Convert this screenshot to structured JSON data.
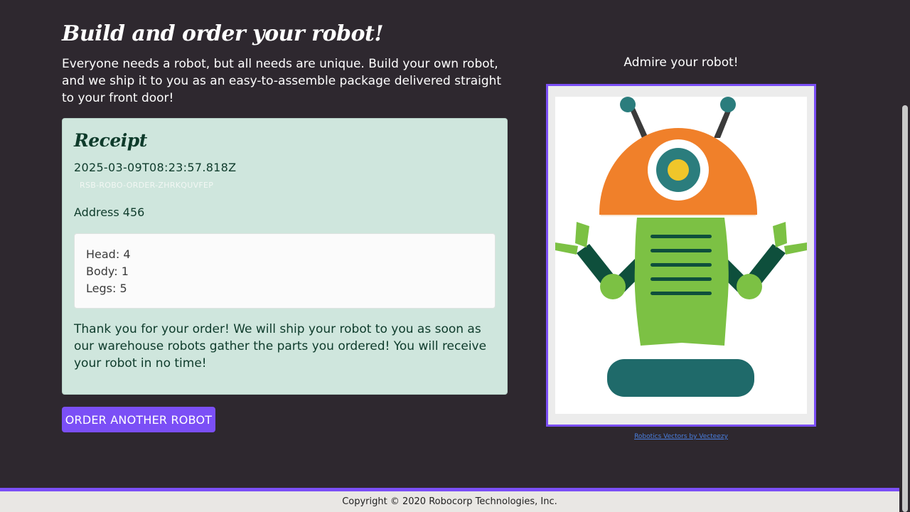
{
  "page": {
    "title": "Build and order your robot!",
    "intro": "Everyone needs a robot, but all needs are unique. Build your own robot, and we ship it to you as an easy-to-assemble package delivered straight to your front door!"
  },
  "receipt": {
    "title": "Receipt",
    "timestamp": "2025-03-09T08:23:57.818Z",
    "order_id": "RSB-ROBO-ORDER-ZHRKQUVFEP",
    "address": "Address 456",
    "parts": {
      "head": "Head: 4",
      "body": "Body: 1",
      "legs": "Legs: 5"
    },
    "thanks": "Thank you for your order! We will ship your robot to you as soon as our warehouse robots gather the parts you ordered! You will receive your robot in no time!"
  },
  "actions": {
    "order_another": "ORDER ANOTHER ROBOT"
  },
  "preview": {
    "label": "Admire your robot!",
    "credit": "Robotics Vectors by Vecteezy"
  },
  "footer": {
    "copyright": "Copyright © 2020 Robocorp Technologies, Inc."
  },
  "colors": {
    "background": "#2e282f",
    "accent": "#7b4ff6",
    "receipt_bg": "#cfe6dd"
  }
}
